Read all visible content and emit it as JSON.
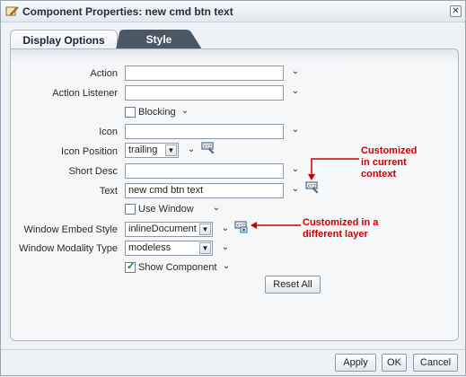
{
  "dialog": {
    "title": "Component Properties: new cmd btn text",
    "close_label": "✕"
  },
  "tabs": [
    {
      "label": "Display Options",
      "active": true
    },
    {
      "label": "Style",
      "active": false
    }
  ],
  "fields": {
    "action": {
      "label": "Action",
      "value": ""
    },
    "action_listener": {
      "label": "Action Listener",
      "value": ""
    },
    "blocking": {
      "label": "Blocking",
      "checked": false
    },
    "icon": {
      "label": "Icon",
      "value": ""
    },
    "icon_position": {
      "label": "Icon Position",
      "value": "trailing"
    },
    "short_desc": {
      "label": "Short Desc",
      "value": ""
    },
    "text": {
      "label": "Text",
      "value": "new cmd btn text"
    },
    "use_window": {
      "label": "Use Window",
      "checked": false
    },
    "window_embed_style": {
      "label": "Window Embed Style",
      "value": "inlineDocument"
    },
    "window_modality_type": {
      "label": "Window Modality Type",
      "value": "modeless"
    },
    "show_component": {
      "label": "Show Component",
      "checked": true
    }
  },
  "reset_all_label": "Reset All",
  "callouts": {
    "current_context": [
      "Customized",
      "in current",
      "context"
    ],
    "different_layer": [
      "Customized in a",
      "different layer"
    ]
  },
  "footer": {
    "apply_label": "Apply",
    "ok_label": "OK",
    "cancel_label": "Cancel"
  },
  "icons": {
    "chevron": "⌄",
    "select_arrow": "▼"
  },
  "colors": {
    "callout_red": "#cc0000",
    "tab_inactive": "#4a5866"
  }
}
